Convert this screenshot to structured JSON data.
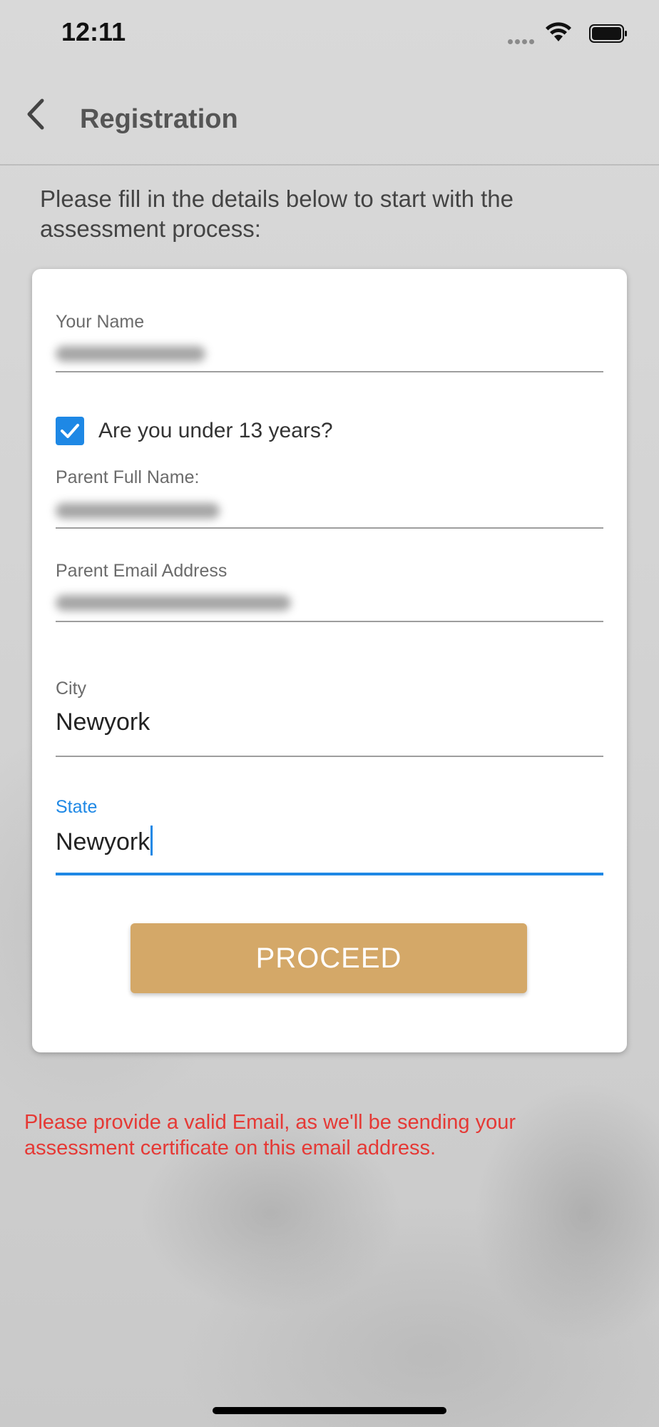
{
  "status_bar": {
    "time": "12:11"
  },
  "nav": {
    "back_icon": "chevron-left-icon",
    "title": "Registration"
  },
  "intro": "Please fill in the details below to start with the assessment process:",
  "form": {
    "name_label": "Your Name",
    "under13_label": "Are you under 13 years?",
    "under13_checked": true,
    "parent_name_label": "Parent Full Name:",
    "parent_email_label": "Parent Email Address",
    "city_label": "City",
    "city_value": "Newyork",
    "state_label": "State",
    "state_value": "Newyork",
    "proceed_label": "PROCEED"
  },
  "warning": "Please provide a valid Email, as we'll be sending your assessment certificate on this email address.",
  "colors": {
    "accent_blue": "#1e88e5",
    "proceed_button": "#d4a868",
    "warning_red": "#e53935"
  }
}
